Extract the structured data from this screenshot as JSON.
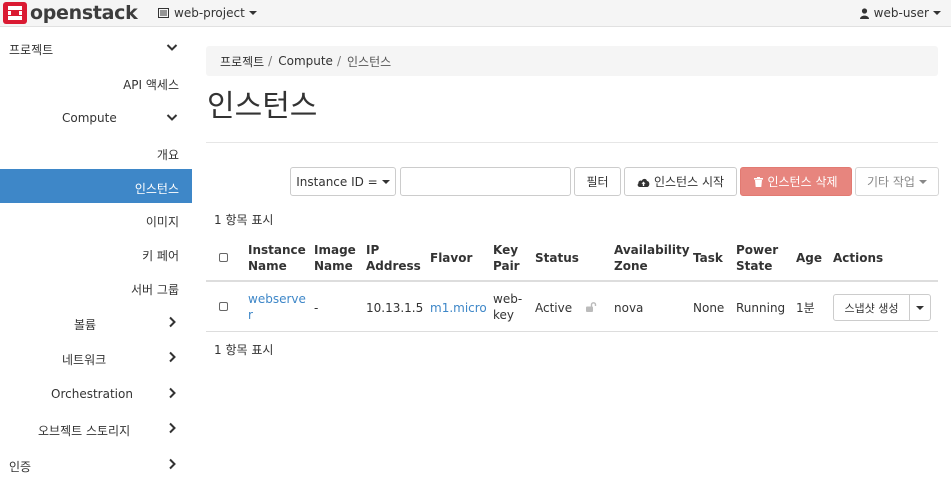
{
  "header": {
    "logo_text": "openstack",
    "project": "web-project",
    "user": "web-user",
    "icons": [
      "openstack-logo-icon",
      "project-list-icon",
      "user-icon"
    ]
  },
  "sidebar": {
    "items": [
      {
        "label": "프로젝트",
        "level": 0,
        "chevron": "down"
      },
      {
        "label": "API 액세스",
        "level": 2
      },
      {
        "label": "Compute",
        "level": 1,
        "chevron": "down"
      },
      {
        "label": "개요",
        "level": 2
      },
      {
        "label": "인스턴스",
        "level": 2,
        "active": true
      },
      {
        "label": "이미지",
        "level": 2
      },
      {
        "label": "키 페어",
        "level": 2
      },
      {
        "label": "서버 그룹",
        "level": 2
      },
      {
        "label": "볼륨",
        "level": 1,
        "chevron": "right"
      },
      {
        "label": "네트워크",
        "level": 1,
        "chevron": "right"
      },
      {
        "label": "Orchestration",
        "level": 1,
        "chevron": "right"
      },
      {
        "label": "오브젝트 스토리지",
        "level": 1,
        "chevron": "right"
      },
      {
        "label": "인증",
        "level": 0,
        "chevron": "right"
      }
    ]
  },
  "breadcrumb": {
    "items": [
      "프로젝트",
      "Compute"
    ],
    "current": "인스턴스",
    "separator": "/"
  },
  "page": {
    "title": "인스턴스"
  },
  "toolbar": {
    "filter_field": "Instance ID =",
    "filter_value": "",
    "filter_button": "필터",
    "launch_button": "인스턴스 시작",
    "delete_button": "인스턴스 삭제",
    "more_button": "기타 작업"
  },
  "table": {
    "count_top": "1 항목 표시",
    "count_bottom": "1 항목 표시",
    "headers": {
      "instance_name": [
        "Instance",
        "Name"
      ],
      "image_name": [
        "Image",
        "Name"
      ],
      "ip_address": [
        "IP",
        "Address"
      ],
      "flavor": "Flavor",
      "key_pair": [
        "Key",
        "Pair"
      ],
      "status": "Status",
      "availability_zone": [
        "Availability",
        "Zone"
      ],
      "task": "Task",
      "power_state": [
        "Power",
        "State"
      ],
      "age": "Age",
      "actions": "Actions"
    },
    "rows": [
      {
        "instance_name": [
          "webserve",
          "r"
        ],
        "image_name": "-",
        "ip_address": "10.13.1.5",
        "flavor": "m1.micro",
        "key_pair": [
          "web-",
          "key"
        ],
        "status": "Active",
        "availability_zone": "nova",
        "task": "None",
        "power_state": "Running",
        "age": "1분",
        "action_label": "스냅샷 생성"
      }
    ]
  },
  "colors": {
    "accent": "#3e87c8",
    "danger": "#e7857e",
    "logo_red": "#da1a32"
  }
}
